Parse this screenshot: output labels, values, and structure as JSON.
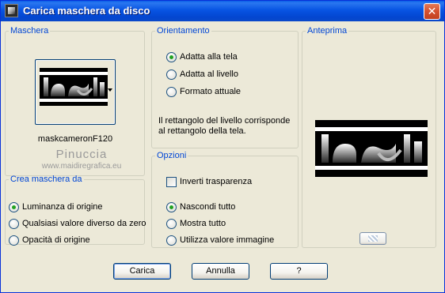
{
  "window": {
    "title": "Carica maschera da disco",
    "close_glyph": "✕"
  },
  "maschera": {
    "legend": "Maschera",
    "mask_name": "maskcameronF120"
  },
  "watermark": {
    "line1": "Pinuccia",
    "line2": "www.maidiregrafica.eu"
  },
  "crea": {
    "legend": "Crea maschera da",
    "options": [
      {
        "label": "Luminanza di origine",
        "checked": true
      },
      {
        "label": "Qualsiasi valore diverso da zero",
        "checked": false
      },
      {
        "label": "Opacità di origine",
        "checked": false
      }
    ]
  },
  "orientamento": {
    "legend": "Orientamento",
    "options": [
      {
        "label": "Adatta alla tela",
        "checked": true
      },
      {
        "label": "Adatta al livello",
        "checked": false
      },
      {
        "label": "Formato attuale",
        "checked": false
      }
    ],
    "info": "Il rettangolo del livello corrisponde al rettangolo della tela."
  },
  "opzioni": {
    "legend": "Opzioni",
    "invert_label": "Inverti trasparenza",
    "invert_checked": false,
    "options": [
      {
        "label": "Nascondi tutto",
        "checked": true
      },
      {
        "label": "Mostra tutto",
        "checked": false
      },
      {
        "label": "Utilizza valore immagine",
        "checked": false
      }
    ]
  },
  "anteprima": {
    "legend": "Anteprima"
  },
  "buttons": {
    "load": "Carica",
    "cancel": "Annulla",
    "help": "?"
  },
  "colors": {
    "title_bar": "#0854e3",
    "legend_text": "#0046d5",
    "dialog_bg": "#ece9d8",
    "radio_checked": "#21a121"
  },
  "icons": {
    "app": "mask-app-icon",
    "close": "close-icon",
    "dropdown": "chevron-down-icon"
  }
}
